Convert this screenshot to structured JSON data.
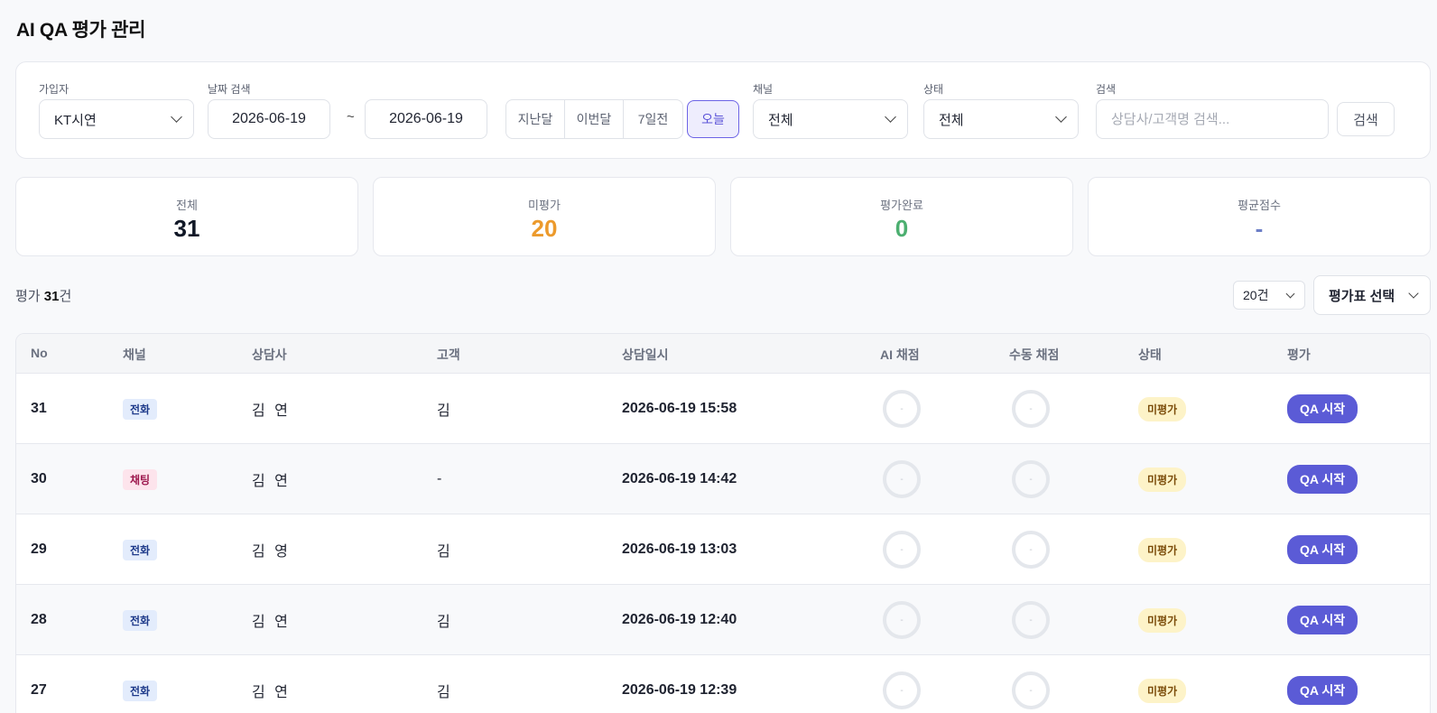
{
  "page": {
    "title": "AI QA 평가 관리"
  },
  "filters": {
    "subscriber": {
      "label": "가입자",
      "value": "KT시연",
      "icon": "chevron-down-icon"
    },
    "date": {
      "label": "날짜 검색",
      "start": "2026-06-19",
      "separator": "~",
      "end": "2026-06-19"
    },
    "quick_ranges": [
      "지난달",
      "이번달",
      "7일전"
    ],
    "today_label": "오늘",
    "channel": {
      "label": "채널",
      "value": "전체",
      "icon": "chevron-down-icon"
    },
    "status": {
      "label": "상태",
      "value": "전체",
      "icon": "chevron-down-icon"
    },
    "search": {
      "label": "검색",
      "value": "",
      "placeholder": "상담사/고객명 검색...",
      "button": "검색"
    }
  },
  "stats": [
    {
      "label": "전체",
      "value": "31",
      "color": "#111827"
    },
    {
      "label": "미평가",
      "value": "20",
      "color": "#ec9a2c"
    },
    {
      "label": "평가완료",
      "value": "0",
      "color": "#4caf70"
    },
    {
      "label": "평균점수",
      "value": "-",
      "color": "#6d7fc7"
    }
  ],
  "list": {
    "count_prefix": "평가 ",
    "count": "31",
    "count_suffix": "건",
    "page_size": "20건",
    "sheet_select": "평가표 선택"
  },
  "table": {
    "columns": [
      "No",
      "채널",
      "상담사",
      "고객",
      "상담일시",
      "AI 채점",
      "수동 채점",
      "상태",
      "평가"
    ],
    "rows": [
      {
        "no": "31",
        "channel": "전화",
        "channel_type": "call",
        "agent": "김 연",
        "customer": "김",
        "datetime": "2026-06-19 15:58",
        "ai_score": "-",
        "manual_score": "-",
        "status": "미평가",
        "action": "QA 시작"
      },
      {
        "no": "30",
        "channel": "채팅",
        "channel_type": "chat",
        "agent": "김 연",
        "customer": "-",
        "datetime": "2026-06-19 14:42",
        "ai_score": "-",
        "manual_score": "-",
        "status": "미평가",
        "action": "QA 시작"
      },
      {
        "no": "29",
        "channel": "전화",
        "channel_type": "call",
        "agent": "김 영",
        "customer": "김",
        "datetime": "2026-06-19 13:03",
        "ai_score": "-",
        "manual_score": "-",
        "status": "미평가",
        "action": "QA 시작"
      },
      {
        "no": "28",
        "channel": "전화",
        "channel_type": "call",
        "agent": "김 연",
        "customer": "김",
        "datetime": "2026-06-19 12:40",
        "ai_score": "-",
        "manual_score": "-",
        "status": "미평가",
        "action": "QA 시작"
      },
      {
        "no": "27",
        "channel": "전화",
        "channel_type": "call",
        "agent": "김 연",
        "customer": "김",
        "datetime": "2026-06-19 12:39",
        "ai_score": "-",
        "manual_score": "-",
        "status": "미평가",
        "action": "QA 시작"
      }
    ]
  }
}
